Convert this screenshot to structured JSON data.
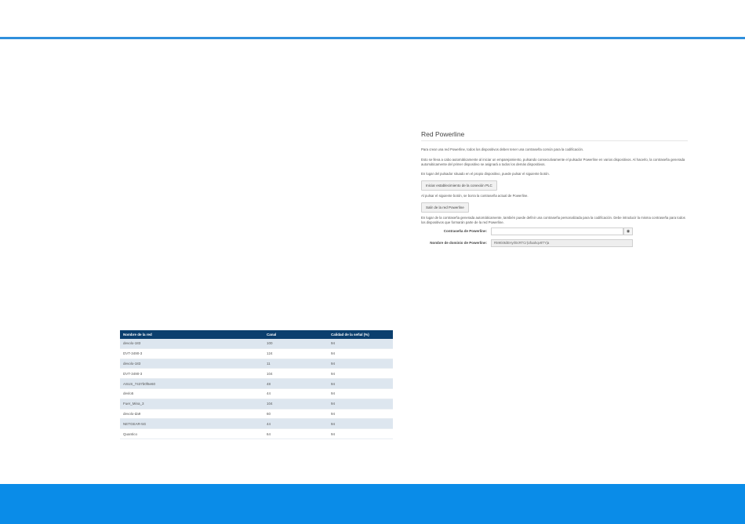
{
  "powerline": {
    "title": "Red Powerline",
    "p1": "Para crear una red Powerline, todos los dispositivos deben tener una contraseña común para la codificación.",
    "p2": "Esto se lleva a cabo automáticamente al iniciar un emparejamiento, pulsando consecutivamente el pulsador Powerline en varios dispositivos. Al hacerlo, la contraseña generada automáticamente del primer dispositivo se asignará a todos los demás dispositivos.",
    "p3": "En lugar del pulsador situado en el propio dispositivo, puede pulsar el siguiente botón.",
    "start_button": "Iniciar establecimiento de la conexión PLC",
    "p4": "Al pulsar el siguiente botón, se borra la contraseña actual de Powerline.",
    "leave_button": "Salir de la red Powerline",
    "p5": "En lugar de la contraseña generada automáticamente, también puede definir una contraseña personalizada para la codificación. Debe introducir la misma contraseña para todos los dispositivos que formarán parte de la red Powerline.",
    "password_label": "Contraseña de Powerline:",
    "password_value": "",
    "eye_icon": "eye-icon",
    "domain_label": "Nombre de dominio de Powerline:",
    "domain_value": "RMKk9dEHyrl0cRTCr|Ufaahqv8TY|a"
  },
  "table": {
    "headers": [
      "Nombre de la red",
      "Canal",
      "Calidad de la señal (%)"
    ],
    "rows": [
      [
        "devolo-183",
        "100",
        "94"
      ],
      [
        "DVT-3490-3",
        "124",
        "94"
      ],
      [
        "devolo-183",
        "11",
        "94"
      ],
      [
        "DVT-3490-3",
        "104",
        "94"
      ],
      [
        "ASUS_7437b0f6e60",
        "48",
        "94"
      ],
      [
        "devlo5",
        "44",
        "94"
      ],
      [
        "Fuer_Mina_3",
        "104",
        "94"
      ],
      [
        "devolo-da9",
        "60",
        "94"
      ],
      [
        "NETGEAR-5G",
        "44",
        "94"
      ],
      [
        "Quantico",
        "64",
        "94"
      ]
    ]
  },
  "colors": {
    "accent_rule": "#2f8fdc",
    "footer": "#0a8ce8",
    "table_header": "#0b3f6e",
    "table_stripe": "#dde6ef"
  }
}
